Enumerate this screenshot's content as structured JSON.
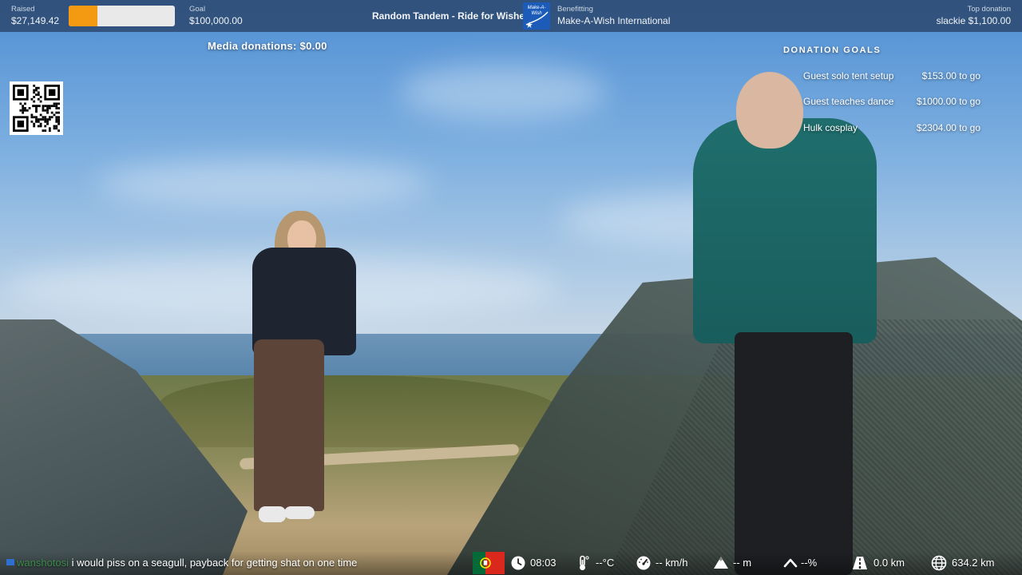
{
  "topbar": {
    "raised_label": "Raised",
    "raised_value": "$27,149.42",
    "progress_fraction": 0.2715,
    "goal_label": "Goal",
    "goal_value": "$100,000.00",
    "stream_title": "Random Tandem - Ride for Wishes",
    "benefitting_label": "Benefitting",
    "charity_name": "Make-A-Wish International",
    "logo_text": "Make-A-Wish",
    "top_donation_label": "Top donation",
    "top_donation_value": "slackie $1,100.00"
  },
  "media_donations": "Media donations: $0.00",
  "goals": {
    "title": "DONATION GOALS",
    "items": [
      {
        "name": "Guest solo tent setup",
        "remaining": "$153.00 to go"
      },
      {
        "name": "Guest teaches dance",
        "remaining": "$1000.00 to go"
      },
      {
        "name": "Hulk cosplay",
        "remaining": "$2304.00 to go"
      }
    ]
  },
  "chat": {
    "username": "wanshotosi",
    "message": "i would piss on a seagull, payback for getting shat on one time"
  },
  "telemetry": {
    "time": "08:03",
    "temperature": "--°C",
    "speed": "-- km/h",
    "altitude": "-- m",
    "incline": "--%",
    "trip_distance": "0.0 km",
    "total_distance": "634.2 km"
  },
  "colors": {
    "topbar_bg": "#243a5c",
    "progress_fill": "#f39a12",
    "progress_track": "#e9e9e9",
    "chat_username": "#3d8a4a",
    "logo_bg": "#1c5cb8"
  },
  "icons": {
    "flag": "portugal-flag-icon",
    "time": "clock-icon",
    "temperature": "thermometer-icon",
    "speed": "speedometer-icon",
    "altitude": "mountain-icon",
    "incline": "incline-icon",
    "trip": "road-icon",
    "total": "globe-icon"
  }
}
